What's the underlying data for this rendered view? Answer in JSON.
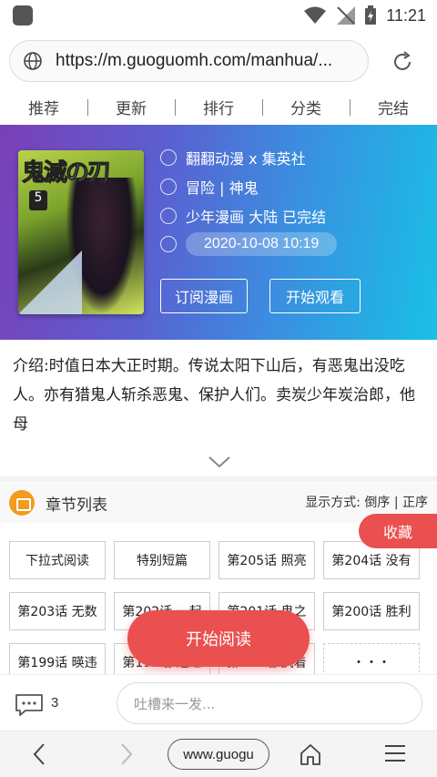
{
  "status_bar": {
    "time": "11:21"
  },
  "address_bar": {
    "url": "https://m.guoguomh.com/manhua/..."
  },
  "nav_tabs": [
    "推荐",
    "更新",
    "排行",
    "分类",
    "完结"
  ],
  "comic": {
    "cover_title": "鬼滅の刃",
    "cover_volume": "5",
    "author": "翻翻动漫 x 集英社",
    "genres": "冒险 | 神鬼",
    "category": "少年漫画 大陆 已完结",
    "update_time": "2020-10-08 10:19",
    "subscribe_label": "订阅漫画",
    "start_watch_label": "开始观看"
  },
  "intro_text": "介绍:时值日本大正时期。传说太阳下山后，有恶鬼出没吃人。亦有猎鬼人斩杀恶鬼、保护人们。卖炭少年炭治郎，他母",
  "chapters": {
    "title": "章节列表",
    "display_mode": "显示方式: 倒序 | 正序",
    "favorite_label": "收藏",
    "items": [
      "下拉式阅读",
      "特别短篇",
      "第205话 照亮",
      "第204话 没有",
      "第203话 无数",
      "第202话 一起",
      "第201话 鬼之",
      "第200话 胜利",
      "第199话 暎违",
      "第198话 通过",
      "第197话 执着",
      "・・・"
    ],
    "start_reading_label": "开始阅读"
  },
  "comment_bar": {
    "count": "3",
    "placeholder": "吐槽来一发..."
  },
  "browser_bar": {
    "url": "www.guogu"
  },
  "colors": {
    "accent": "#e9504f",
    "chapter_icon": "#f39a1f"
  }
}
